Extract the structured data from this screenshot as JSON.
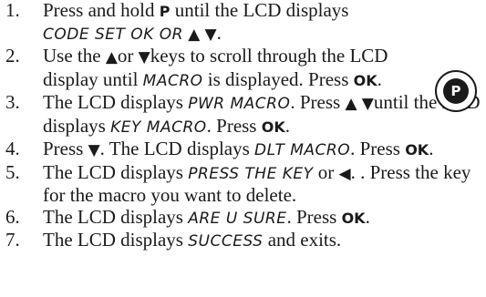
{
  "keys": {
    "p": "P",
    "ok": "OK"
  },
  "arrows": {
    "up": "▲",
    "down": "▼",
    "left": "◀"
  },
  "lcd": {
    "code_set": "CODE SET OK OR",
    "macro": "MACRO",
    "pwr_macro": "PWR MACRO",
    "key_macro": "KEY MACRO",
    "dlt_macro": "DLT MACRO",
    "press_the_key": "PRESS THE KEY",
    "are_u_sure": "ARE U SURE",
    "success": "SUCCESS"
  },
  "steps": [
    {
      "num": "1.",
      "a": "Press and hold ",
      "b": " until the LCD displays"
    },
    {
      "num": "2.",
      "a": "Use the ",
      "b": "or ",
      "c": "keys to scroll through the LCD display until ",
      "d": " is displayed. Press "
    },
    {
      "num": "3.",
      "a": "The LCD displays ",
      "b": ". Press ",
      "c": "until the LCD displays ",
      "d": ". Press "
    },
    {
      "num": "4.",
      "a": "Press ",
      "b": ". The LCD displays ",
      "c": ". Press "
    },
    {
      "num": "5.",
      "a": "The LCD displays ",
      "b": " or ",
      "c": ". Press the key for the macro you want to delete."
    },
    {
      "num": "6.",
      "a": "The LCD displays ",
      "b": ". Press "
    },
    {
      "num": "7.",
      "a": "The LCD displays ",
      "b": " and exits."
    }
  ],
  "icon": {
    "label": "P",
    "name": "p-button-icon"
  }
}
